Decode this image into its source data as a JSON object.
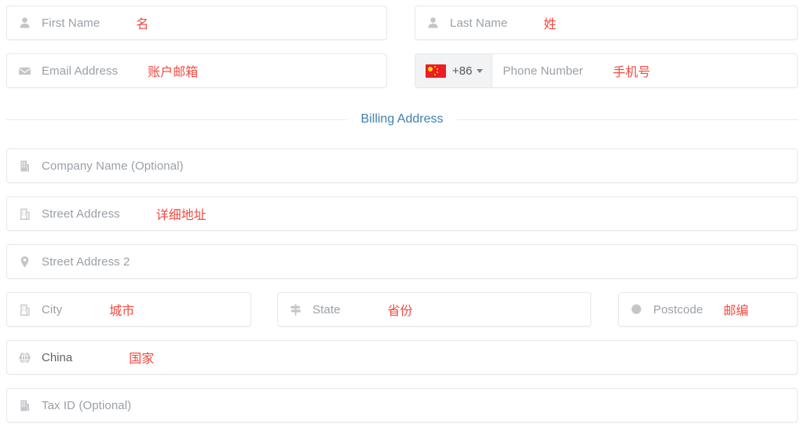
{
  "form": {
    "rows": {
      "first_name": {
        "placeholder": "First Name",
        "annotation": "名",
        "icon": "user-icon"
      },
      "last_name": {
        "placeholder": "Last Name",
        "annotation": "姓",
        "icon": "user-icon"
      },
      "email": {
        "placeholder": "Email Address",
        "annotation": "账户邮箱",
        "icon": "envelope-icon"
      },
      "phone": {
        "placeholder": "Phone Number",
        "annotation": "手机号",
        "dial_code": "+86",
        "flag": "china-flag-icon",
        "caret": "chevron-down-icon"
      },
      "company": {
        "placeholder": "Company Name (Optional)",
        "annotation": "",
        "icon": "building-icon"
      },
      "street": {
        "placeholder": "Street Address",
        "annotation": "详细地址",
        "icon": "building-icon"
      },
      "street2": {
        "placeholder": "Street Address 2",
        "annotation": "",
        "icon": "map-pin-icon"
      },
      "city": {
        "placeholder": "City",
        "annotation": "城市",
        "icon": "building-icon"
      },
      "state": {
        "placeholder": "State",
        "annotation": "省份",
        "icon": "signpost-icon"
      },
      "postcode": {
        "placeholder": "Postcode",
        "annotation": "邮编",
        "icon": "gear-icon"
      },
      "country": {
        "value": "China",
        "annotation": "国家",
        "icon": "globe-icon"
      },
      "tax_id": {
        "placeholder": "Tax ID (Optional)",
        "annotation": "",
        "icon": "building-icon"
      }
    },
    "divider": {
      "title": "Billing Address"
    }
  },
  "colors": {
    "annotation_red": "#f4493f",
    "divider_blue": "#3f7fb0",
    "placeholder_grey": "#9aa0a6",
    "border_grey": "#e6e8ea",
    "icon_grey": "#c3c6c9",
    "flag_red": "#ee1c25",
    "flag_yellow": "#ffde00"
  }
}
